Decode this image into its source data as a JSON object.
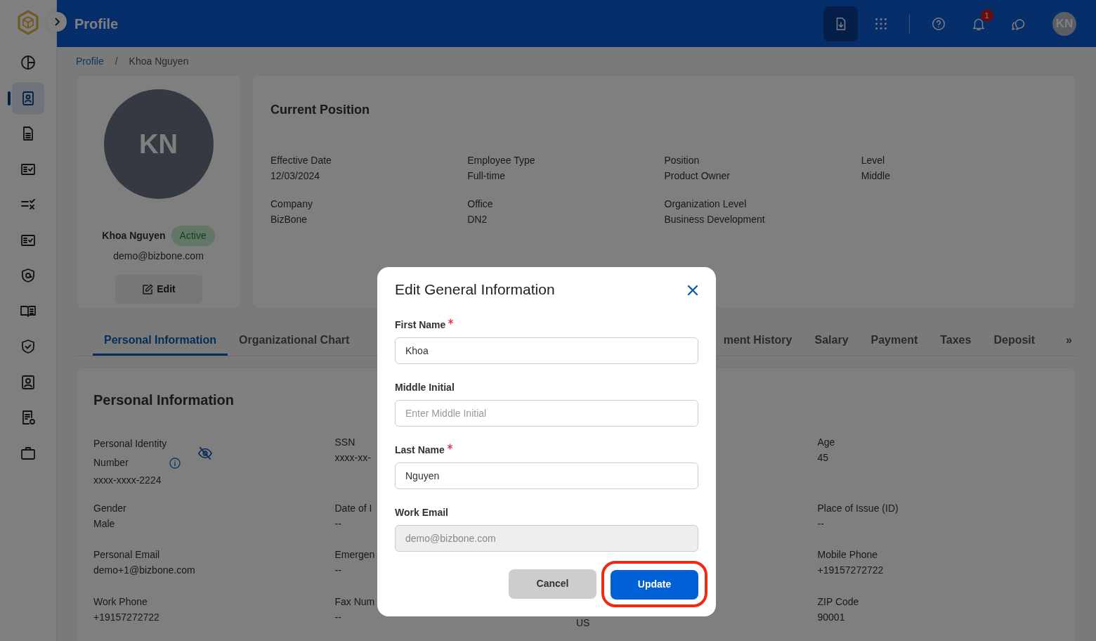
{
  "header": {
    "title": "Profile",
    "notification_count": "1",
    "avatar": "KN",
    "actions": [
      {
        "kind": "download",
        "selected": true
      },
      {
        "kind": "apps",
        "selected": false
      }
    ]
  },
  "sidebar": {
    "items": [
      {
        "selected": false
      },
      {
        "selected": true
      },
      {
        "selected": false
      },
      {
        "selected": false
      },
      {
        "selected": false
      },
      {
        "selected": false
      },
      {
        "selected": false
      },
      {
        "selected": false
      },
      {
        "selected": false
      },
      {
        "selected": false
      },
      {
        "selected": false
      },
      {
        "selected": false
      }
    ]
  },
  "breadcrumb": {
    "separator": "/",
    "items": [
      "Profile",
      "Khoa Nguyen"
    ]
  },
  "profile": {
    "initials": "KN",
    "name": "Khoa Nguyen",
    "status": "Active",
    "email": "demo@bizbone.com",
    "edit_button": "Edit"
  },
  "current_position": {
    "title": "Current Position",
    "fields": [
      {
        "label": "Effective Date",
        "value": "12/03/2024"
      },
      {
        "label": "Employee Type",
        "value": "Full-time"
      },
      {
        "label": "Position",
        "value": "Product Owner"
      },
      {
        "label": "Level",
        "value": "Middle"
      },
      {
        "label": "Company",
        "value": "BizBone"
      },
      {
        "label": "Office",
        "value": "DN2"
      },
      {
        "label": "Organization Level",
        "value": "Business Development"
      }
    ]
  },
  "tabs": [
    {
      "label": "Personal Information",
      "selected": true
    },
    {
      "label": "Organizational Chart",
      "selected": false
    },
    {
      "label": "ment History",
      "selected": false
    },
    {
      "label": "Salary",
      "selected": false
    },
    {
      "label": "Payment",
      "selected": false
    },
    {
      "label": "Taxes",
      "selected": false
    },
    {
      "label": "Deposit",
      "selected": false
    }
  ],
  "tabs_more": "»",
  "personal_information": {
    "title": "Personal Information",
    "columns": [
      [
        {
          "label": "Personal Identity Number",
          "value": "xxxx-xxxx-2224",
          "kind": "masked"
        },
        {
          "label": "Gender",
          "value": "Male"
        },
        {
          "label": "Personal Email",
          "value": "demo+1@bizbone.com"
        },
        {
          "label": "Work Phone",
          "value": "+19157272722"
        }
      ],
      [
        {
          "label": "SSN",
          "value": "xxxx-xx-"
        },
        {
          "label": "Date of I",
          "value": "--"
        },
        {
          "label": "Emergen",
          "value": "--"
        },
        {
          "label": "Fax Num",
          "value": "--"
        }
      ],
      [
        {},
        {},
        {},
        {
          "value": "US"
        }
      ],
      [
        {
          "label": "Age",
          "value": "45"
        },
        {
          "label": "Place of Issue (ID)",
          "value": "--"
        },
        {
          "label": "Mobile Phone",
          "value": "+19157272722"
        },
        {
          "label": "ZIP Code",
          "value": "90001"
        }
      ]
    ]
  },
  "modal": {
    "title": "Edit General Information",
    "fields": [
      {
        "label": "First Name",
        "required": true,
        "value": "Khoa",
        "disabled": false
      },
      {
        "label": "Middle Initial",
        "required": false,
        "placeholder": "Enter Middle Initial",
        "disabled": false
      },
      {
        "label": "Last Name",
        "required": true,
        "value": "Nguyen",
        "disabled": false
      },
      {
        "label": "Work Email",
        "required": false,
        "value": "demo@bizbone.com",
        "disabled": true
      }
    ],
    "cancel_button": "Cancel",
    "update_button": {
      "label": "Update",
      "highlighted": true
    }
  }
}
